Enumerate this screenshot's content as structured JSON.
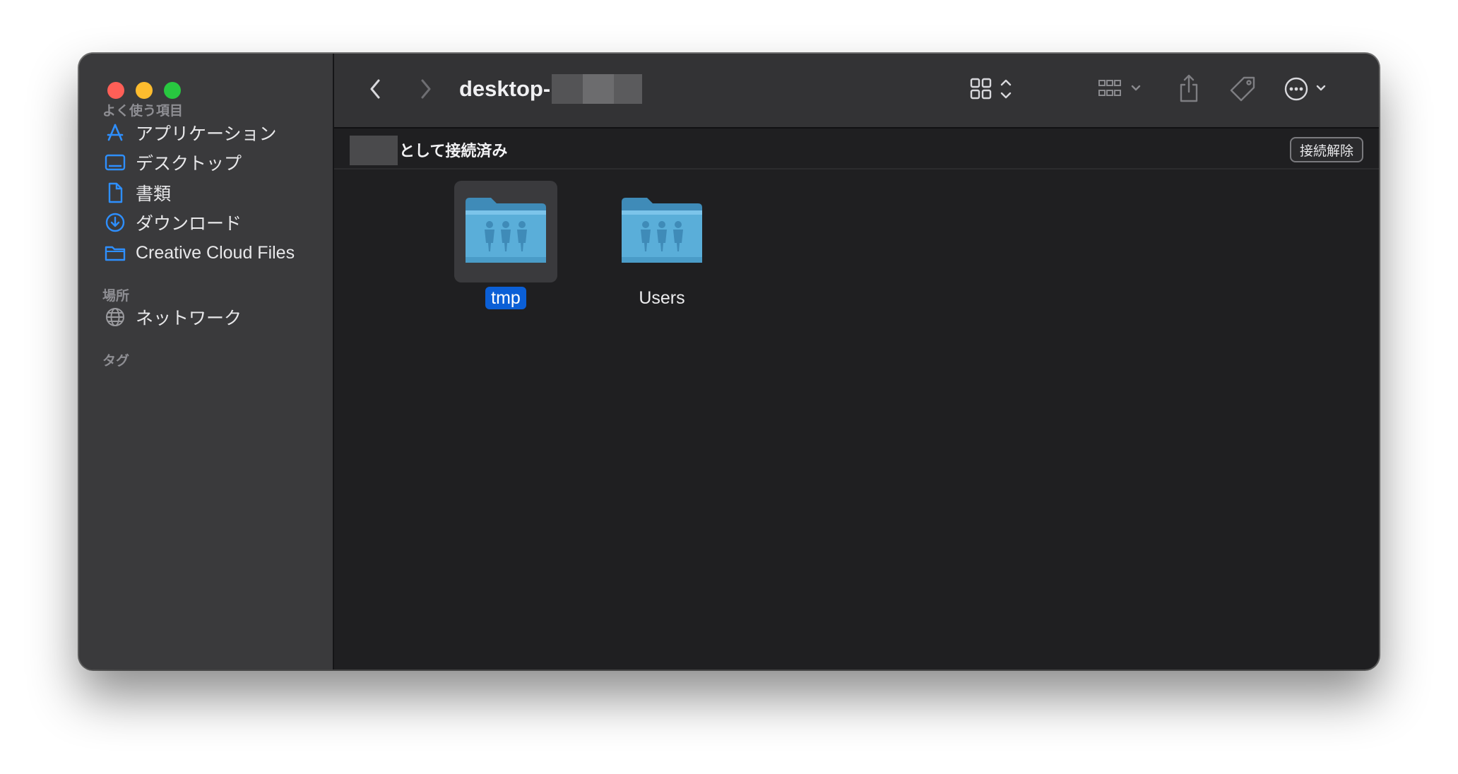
{
  "window": {
    "title_visible": "desktop-",
    "title_redacted": true
  },
  "sidebar": {
    "favorites_title": "よく使う項目",
    "favorites": [
      {
        "label": "アプリケーション",
        "icon": "applications-icon"
      },
      {
        "label": "デスクトップ",
        "icon": "desktop-icon"
      },
      {
        "label": "書類",
        "icon": "document-icon"
      },
      {
        "label": "ダウンロード",
        "icon": "download-icon"
      },
      {
        "label": "Creative Cloud Files",
        "icon": "folder-icon"
      }
    ],
    "locations_title": "場所",
    "locations": [
      {
        "label": "ネットワーク",
        "icon": "network-icon"
      }
    ],
    "tags_title": "タグ"
  },
  "toolbar": {
    "back": "chevron-left-icon",
    "forward": "chevron-right-icon",
    "view_mode": "icon-grid-icon",
    "group": "group-icon",
    "share": "share-icon",
    "tag": "tag-icon",
    "more": "ellipsis-circle-icon",
    "search": "search-icon"
  },
  "connection": {
    "status_text": "として接続済み",
    "disconnect_label": "接続解除"
  },
  "files": [
    {
      "name": "tmp",
      "selected": true
    },
    {
      "name": "Users",
      "selected": false
    }
  ],
  "colors": {
    "accent": "#0b5fd6",
    "sidebar_icon": "#2e8fff",
    "folder": "#5aaed9"
  }
}
